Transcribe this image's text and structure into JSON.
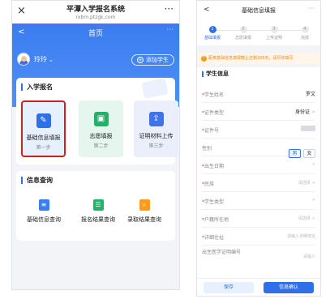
{
  "left": {
    "browser": {
      "title": "平潭入学报名系统",
      "url": "rxbm.ptzgk.com",
      "close": "×",
      "more": "···"
    },
    "header": {
      "back": "<",
      "title": "首页",
      "more": "···"
    },
    "user": {
      "name": "玲玲",
      "chevron": "⌄",
      "add_student": "添加学生",
      "add_icon": "+"
    },
    "registration": {
      "title": "入学报名",
      "tiles": [
        {
          "label": "基础信息填报",
          "step": "第一步",
          "icon": "edit-doc-icon",
          "glyph": "✎",
          "color": "#2f6fe8"
        },
        {
          "label": "志愿填报",
          "step": "第二步",
          "icon": "folder-icon",
          "glyph": "▣",
          "color": "#21b26a"
        },
        {
          "label": "证明材料上传",
          "step": "第三步",
          "icon": "upload-icon",
          "glyph": "⇪",
          "color": "#3e73ea"
        }
      ]
    },
    "query": {
      "title": "信息查询",
      "items": [
        {
          "label": "基础信息查询",
          "icon": "doc-query-icon",
          "glyph": "≡"
        },
        {
          "label": "报名结果查询",
          "icon": "list-icon",
          "glyph": "☰"
        },
        {
          "label": "录取结果查询",
          "icon": "search-icon",
          "glyph": "⌕"
        }
      ]
    },
    "highlight_color": "#d11f1f"
  },
  "right": {
    "header": {
      "back": "<",
      "title": "基础信息填报",
      "more": "···"
    },
    "steps": [
      {
        "num": "1",
        "label": "基础填报"
      },
      {
        "num": "2",
        "label": "志愿填报"
      },
      {
        "num": "3",
        "label": "上传证明"
      },
      {
        "num": "4",
        "label": "完成"
      }
    ],
    "notice": {
      "icon": "!",
      "text": "距离基础信息填报截止还剩206天，请尽快填写"
    },
    "form": {
      "section": "学生信息",
      "fields": [
        {
          "label": "学生姓名",
          "required": "*",
          "value": "罗文"
        },
        {
          "label": "证件类型",
          "required": "*",
          "value": "身份证",
          "chevron": ">"
        },
        {
          "label": "证件号",
          "required": "*"
        },
        {
          "label": "性别",
          "required": "",
          "opt_male": "男",
          "opt_female": "女"
        },
        {
          "label": "出生日期",
          "required": "*",
          "chevron": ">"
        },
        {
          "label": "民族",
          "required": "*",
          "placeholder": "请选择",
          "chevron": ">"
        },
        {
          "label": "学生类型",
          "required": "*",
          "chevron": ">"
        },
        {
          "label": "户籍所在地",
          "required": "*",
          "placeholder": "请选择",
          "chevron": ">"
        },
        {
          "label": "详细住址",
          "required": "*",
          "placeholder": "请输入详细地址"
        },
        {
          "label": "出生医学证明编号",
          "required": "",
          "placeholder": "请输入"
        }
      ]
    },
    "buttons": {
      "save": "保存",
      "confirm": "信息确认"
    }
  }
}
